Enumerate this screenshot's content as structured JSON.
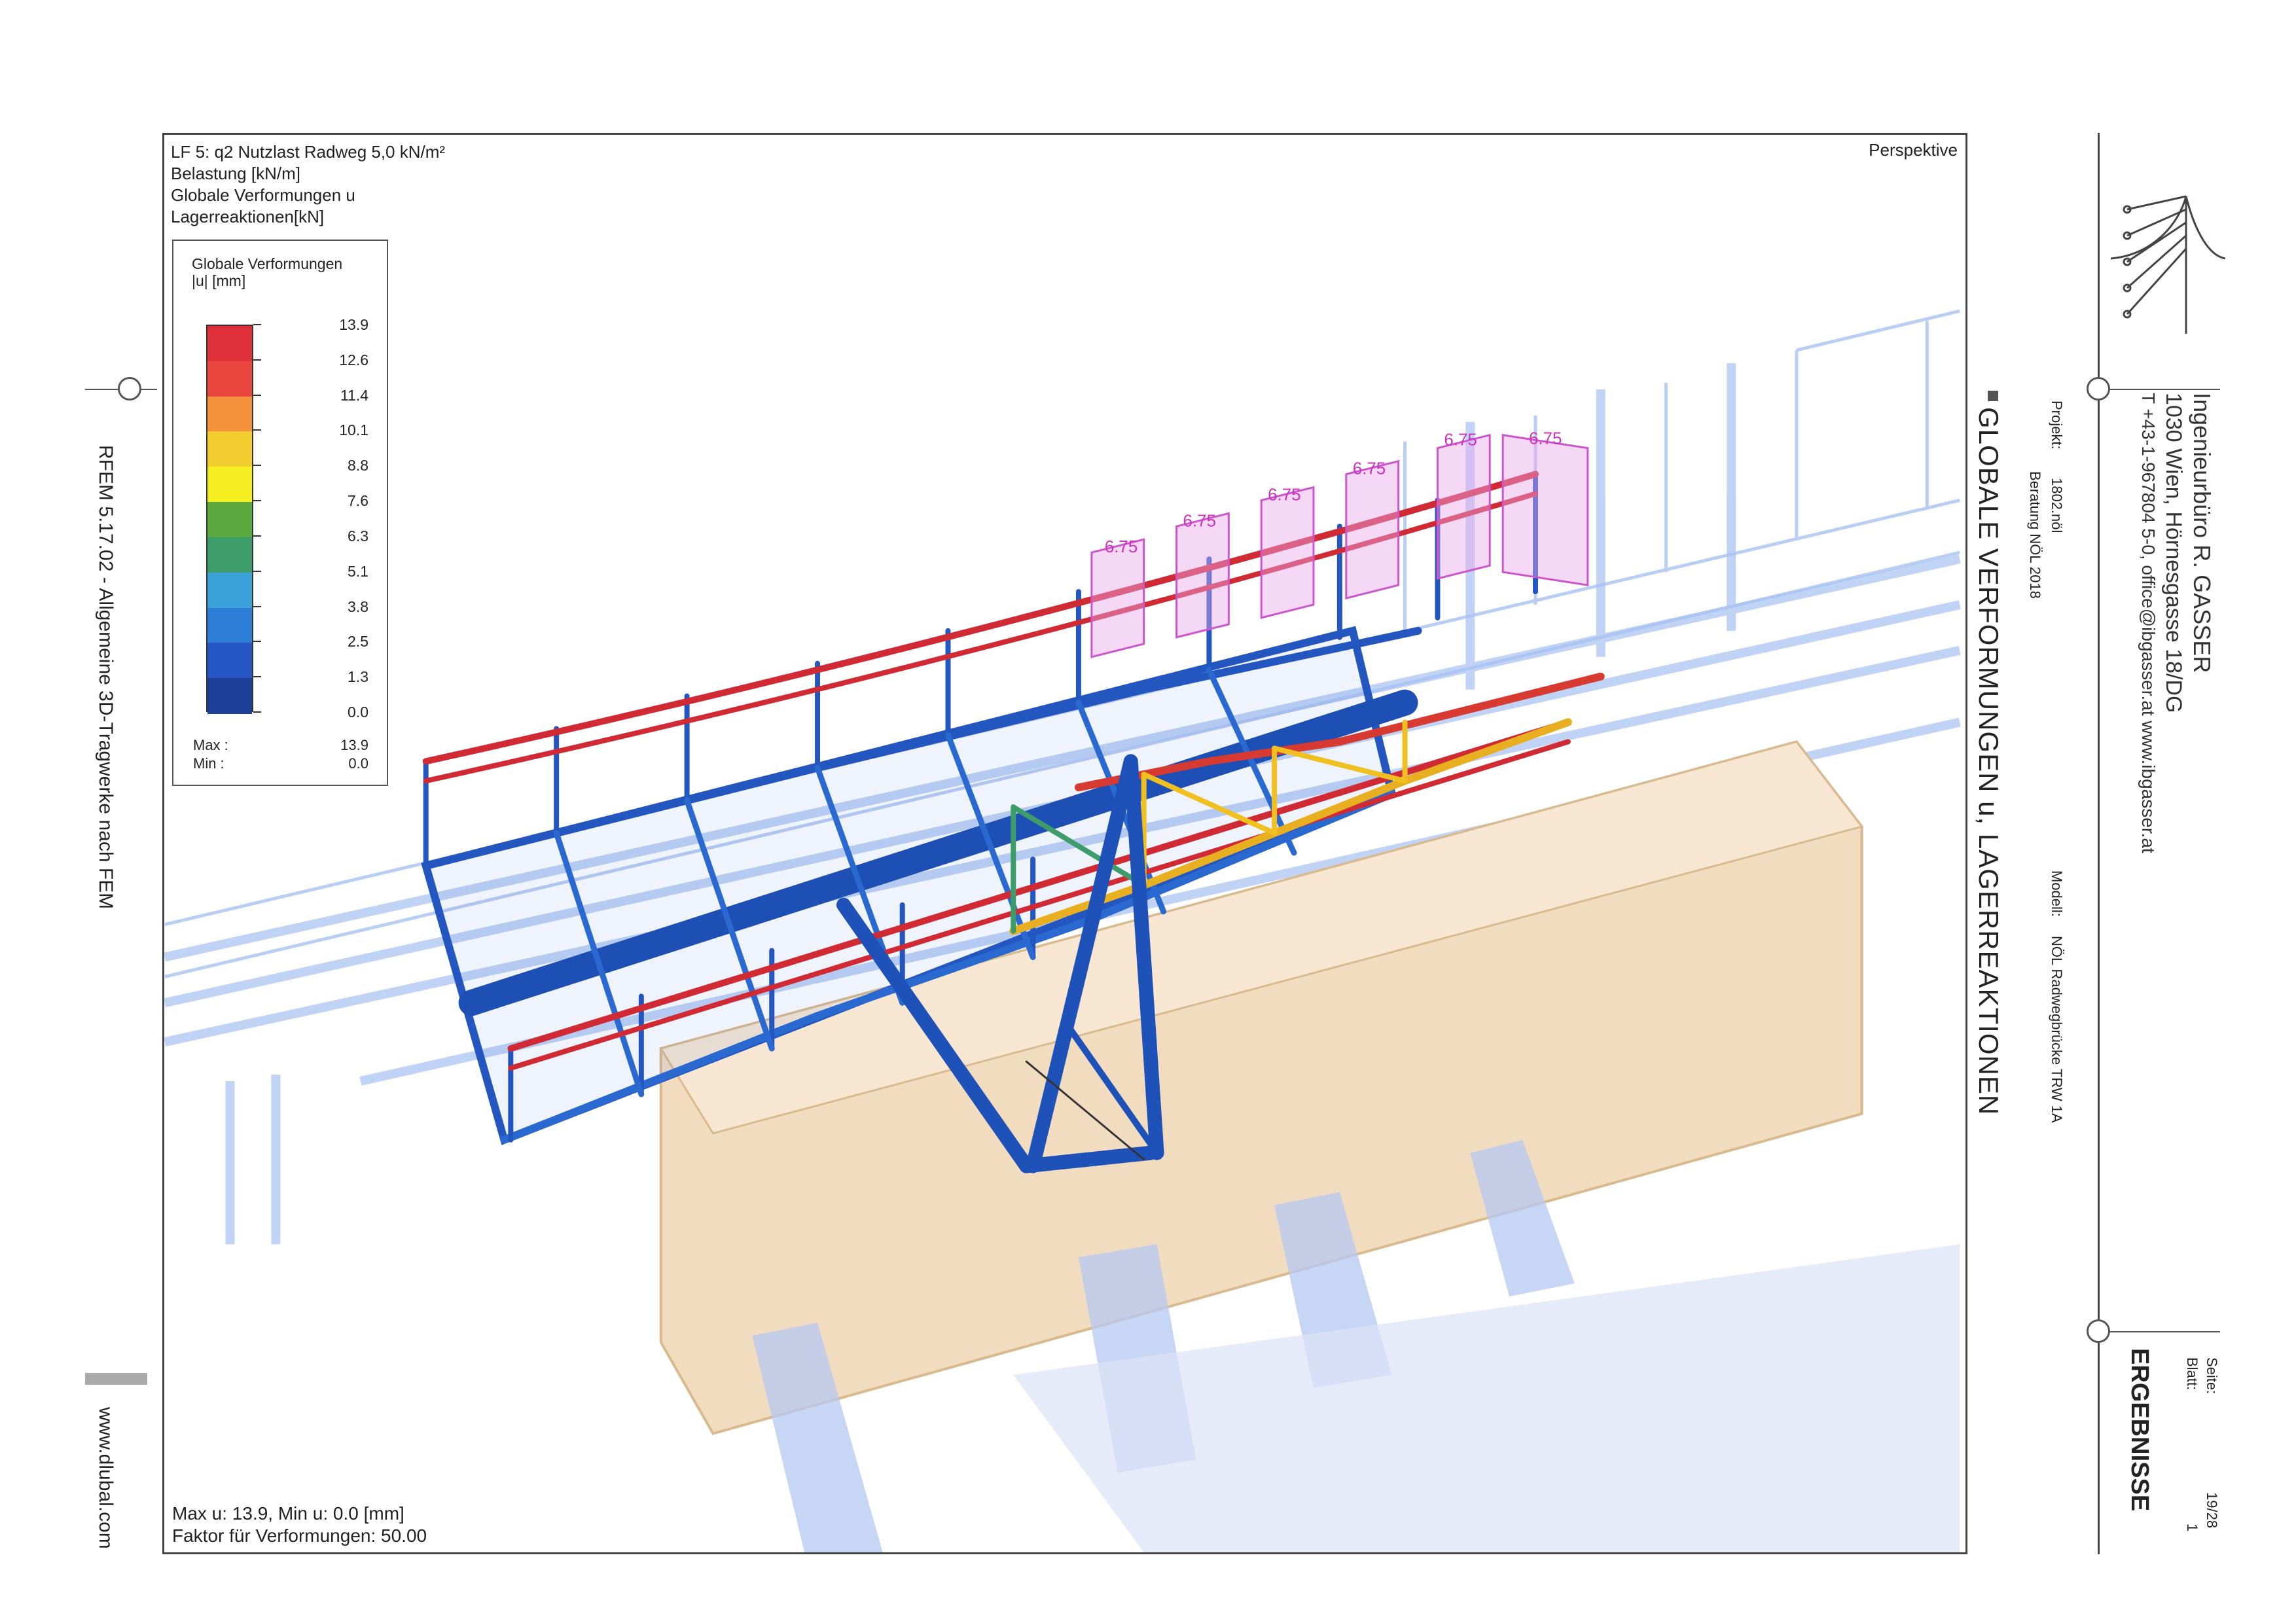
{
  "viewport": {
    "title_lines": [
      "LF 5: q2 Nutzlast Radweg 5,0 kN/m²",
      "Belastung [kN/m]",
      "Globale Verformungen u",
      "Lagerreaktionen[kN]"
    ],
    "view_label": "Perspektive",
    "bottom_lines": [
      "Max u: 13.9, Min u: 0.0 [mm]",
      "Faktor für Verformungen: 50.00"
    ]
  },
  "legend": {
    "title": "Globale Verformungen",
    "unit": "|u| [mm]",
    "levels": [
      "13.9",
      "12.6",
      "11.4",
      "10.1",
      "8.8",
      "7.6",
      "6.3",
      "5.1",
      "3.8",
      "2.5",
      "1.3",
      "0.0"
    ],
    "colors": [
      "#e0303a",
      "#e8463e",
      "#f4913a",
      "#f2cd2e",
      "#f5ee20",
      "#5aa83e",
      "#3e9c6a",
      "#3aa0d8",
      "#2f7fd8",
      "#2757c4",
      "#1e3f96"
    ],
    "max_label": "Max :",
    "max_value": "13.9",
    "min_label": "Min :",
    "min_value": "0.0"
  },
  "load_labels": [
    "6.75",
    "6.75",
    "6.75",
    "6.75",
    "6.75",
    "6.75"
  ],
  "left_margin": {
    "software": "RFEM 5.17.02 - Allgemeine 3D-Tragwerke nach FEM",
    "website": "www.dlubal.com"
  },
  "title_block": {
    "company": "Ingenieurbüro R. GASSER",
    "address": "1030 Wien, Hörnesgasse 18/DG",
    "contact": "T +43-1-967804 5-0, office@ibgasser.at   www.ibgasser.at",
    "projekt_label": "Projekt:",
    "projekt_value": "1802.nöl",
    "modell_label": "Modell:",
    "modell_value": "NÖL Radwegbrücke TRW 1A",
    "beratung": "Beratung NÖL 2018",
    "section_title": "GLOBALE VERFORMUNGEN u, LAGERREAKTIONEN",
    "results": "ERGEBNISSE",
    "seite_label": "Seite:",
    "seite_value": "19/28",
    "blatt_label": "Blatt:",
    "blatt_value": "1"
  }
}
